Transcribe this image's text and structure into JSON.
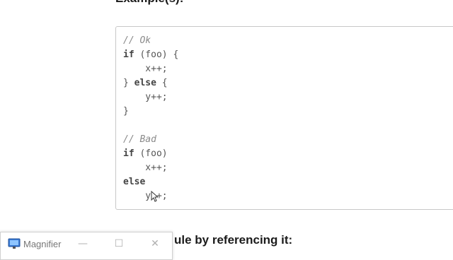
{
  "heading": "Example(s):",
  "code_lines": [
    {
      "text": "// Ok",
      "style": "comment"
    },
    {
      "text": "if",
      "rest": " (foo) {",
      "style": "kw"
    },
    {
      "text": "    x++;",
      "style": "plain"
    },
    {
      "text": "} ",
      "kw2": "else",
      "rest": " {",
      "style": "mixed"
    },
    {
      "text": "    y++;",
      "style": "plain"
    },
    {
      "text": "}",
      "style": "plain"
    },
    {
      "text": "",
      "style": "plain"
    },
    {
      "text": "// Bad",
      "style": "comment"
    },
    {
      "text": "if",
      "rest": " (foo)",
      "style": "kw"
    },
    {
      "text": "    x++;",
      "style": "plain"
    },
    {
      "text": "else",
      "style": "kwonly"
    },
    {
      "text": "    y++;",
      "style": "plain"
    }
  ],
  "bottom_text": "ule by referencing it:",
  "magnifier": {
    "title": "Magnifier",
    "minimize": "—",
    "maximize": "☐",
    "close": "✕"
  }
}
